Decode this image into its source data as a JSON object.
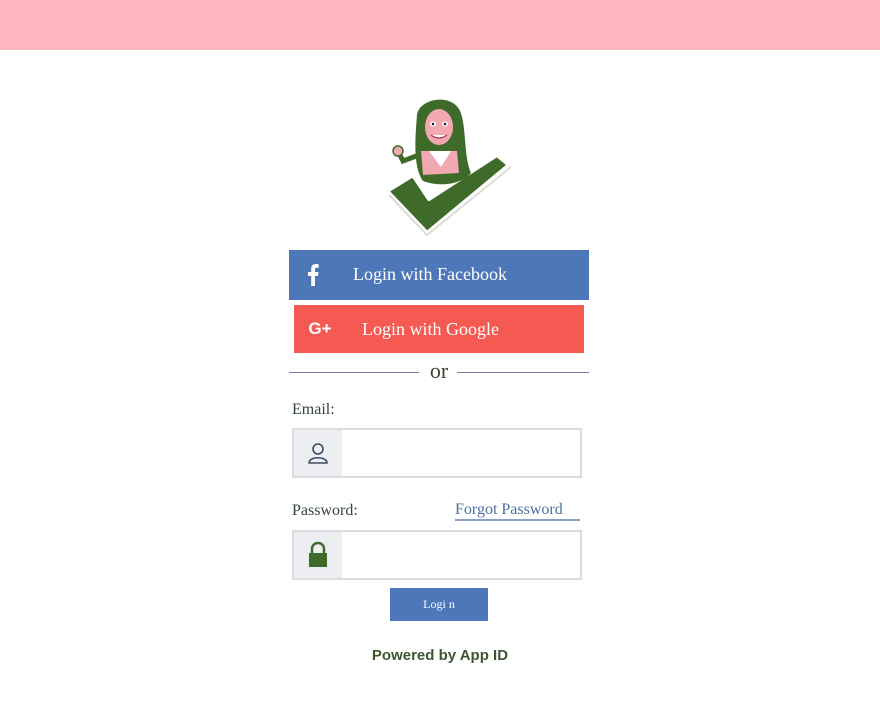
{
  "colors": {
    "top_bar": "#ffb6c1",
    "facebook": "#4d77b9",
    "google": "#f45a52",
    "login_button": "#4d77b9",
    "accent_green": "#3f6b2a"
  },
  "logo": {
    "icon": "avatar-checkmark-logo"
  },
  "social": {
    "facebook": {
      "icon": "facebook-icon",
      "glyph": "f",
      "label": "Login with Facebook"
    },
    "google": {
      "icon": "google-plus-icon",
      "glyph": "G+",
      "label": "Login with Google"
    }
  },
  "divider": {
    "text": "or"
  },
  "form": {
    "email": {
      "label": "Email:",
      "icon": "user-icon",
      "value": "",
      "placeholder": ""
    },
    "password": {
      "label": "Password:",
      "icon": "lock-icon",
      "value": "",
      "placeholder": ""
    },
    "forgot_password": "Forgot Password",
    "login_button": "Logi n"
  },
  "footer": {
    "powered_by": "Powered by App ID"
  }
}
